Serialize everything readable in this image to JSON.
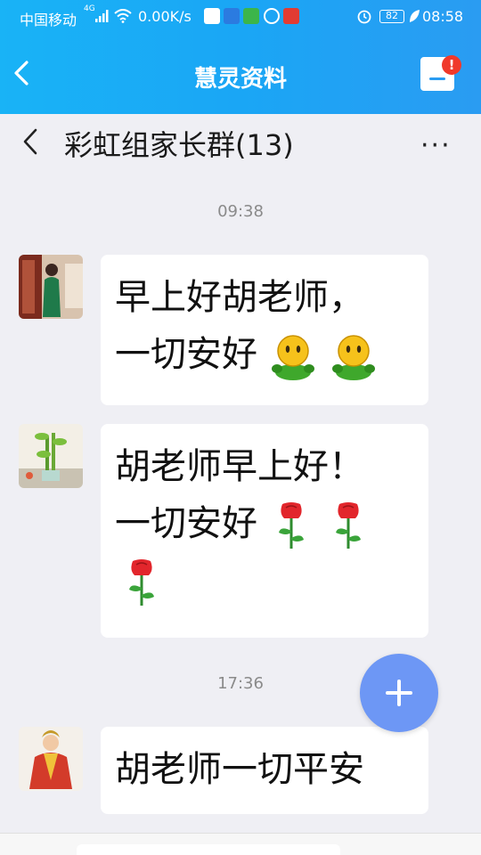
{
  "status_bar": {
    "carrier": "中国移动",
    "network": "4G",
    "speed": "0.00K/s",
    "battery": "82",
    "time": "08:58"
  },
  "app_header": {
    "title": "慧灵资料",
    "notification_badge": "!"
  },
  "chat_header": {
    "group_name": "彩虹组家长群(13)",
    "more": "···"
  },
  "messages": [
    {
      "timestamp": "09:38",
      "line1": "早上好胡老师，",
      "line2": "一切安好",
      "emoji": "smiley-face-icon"
    },
    {
      "line1": "胡老师早上好！",
      "line2": "一切安好",
      "emoji": "rose-icon"
    },
    {
      "timestamp": "17:36",
      "line1": "胡老师一切平安"
    }
  ],
  "colors": {
    "header_gradient_start": "#19b3f6",
    "header_gradient_end": "#2a9cf2",
    "chat_background": "#efeff4",
    "fab": "#6d97f5",
    "badge": "#f0392b"
  }
}
